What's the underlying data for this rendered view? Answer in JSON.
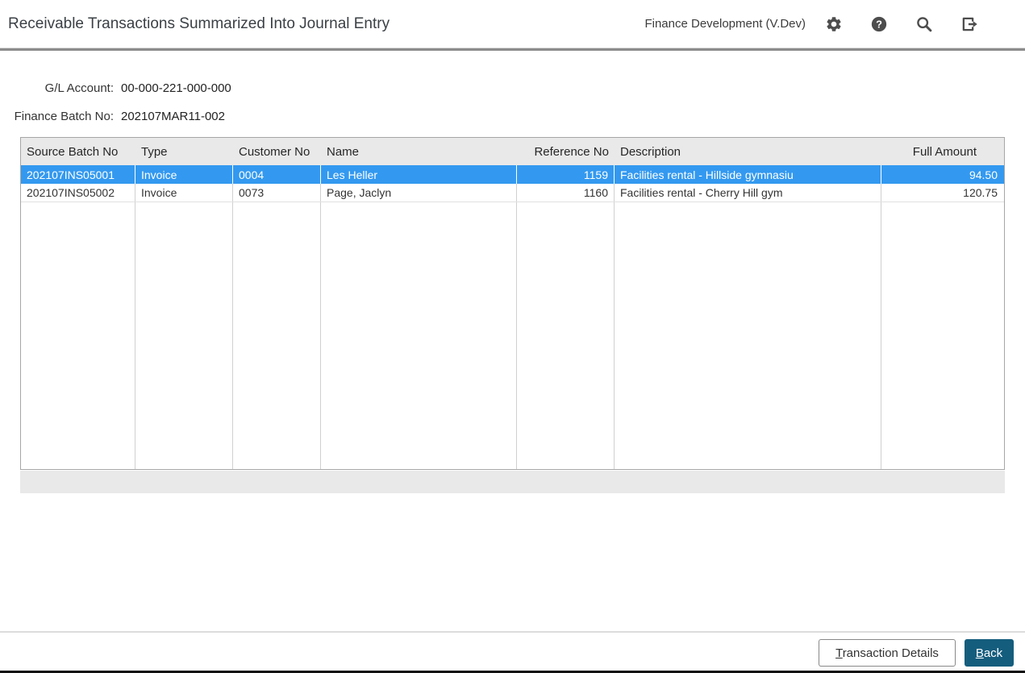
{
  "app": {
    "title": "Receivable Transactions Summarized Into Journal Entry",
    "environment": "Finance Development (V.Dev)",
    "icons": [
      "settings-icon",
      "help-icon",
      "search-icon",
      "signout-icon"
    ]
  },
  "fields": {
    "gl_account": {
      "label": "G/L Account:",
      "value": "00-000-221-000-000"
    },
    "finance_batch_no": {
      "label": "Finance Batch No:",
      "value": "202107MAR11-002"
    }
  },
  "grid": {
    "columns": [
      "Source Batch No",
      "Type",
      "Customer No",
      "Name",
      "Reference No",
      "Description",
      "Full Amount"
    ],
    "rows": [
      {
        "selected": true,
        "cells": [
          "202107INS05001",
          "Invoice",
          "0004",
          "Les Heller",
          "1159",
          "Facilities rental - Hillside gymnasiu",
          "94.50"
        ]
      },
      {
        "selected": false,
        "cells": [
          "202107INS05002",
          "Invoice",
          "0073",
          "Page, Jaclyn",
          "1160",
          "Facilities rental - Cherry Hill gym",
          "120.75"
        ]
      }
    ]
  },
  "buttons": {
    "transaction_details": "Transaction Details",
    "back": "Back"
  },
  "colors": {
    "selected_row": "#3399f0",
    "primary_button": "#155d7d",
    "icon": "#4d4d4d",
    "header_divider": "#8c8c8c",
    "grid_header_bg": "#e9e9e9"
  }
}
